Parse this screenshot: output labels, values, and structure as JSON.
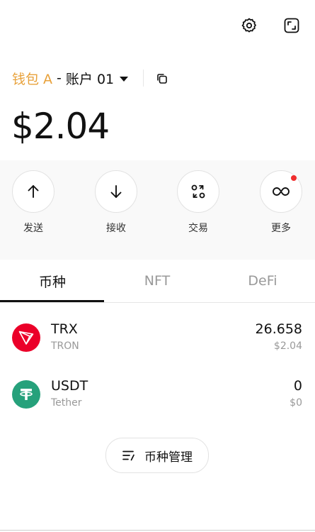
{
  "header": {
    "settings_icon": "gear-icon",
    "expand_icon": "expand-icon"
  },
  "account": {
    "wallet_name": "钱包 A",
    "separator": "-",
    "account_name": "账户 01",
    "copy_icon": "copy-icon"
  },
  "balance": "$2.04",
  "actions": [
    {
      "label": "发送",
      "icon": "arrow-up-icon"
    },
    {
      "label": "接收",
      "icon": "arrow-down-icon"
    },
    {
      "label": "交易",
      "icon": "swap-icon"
    },
    {
      "label": "更多",
      "icon": "more-icon"
    }
  ],
  "tabs": [
    {
      "label": "币种",
      "active": true
    },
    {
      "label": "NFT",
      "active": false
    },
    {
      "label": "DeFi",
      "active": false
    }
  ],
  "tokens": [
    {
      "symbol": "TRX",
      "name": "TRON",
      "amount": "26.658",
      "usd": "$2.04",
      "color": "#EB0029"
    },
    {
      "symbol": "USDT",
      "name": "Tether",
      "amount": "0",
      "usd": "$0",
      "color": "#26A17B"
    }
  ],
  "manage_button": "币种管理",
  "colors": {
    "wallet_accent": "#E8A13A",
    "notification_dot": "#F02D2D"
  }
}
